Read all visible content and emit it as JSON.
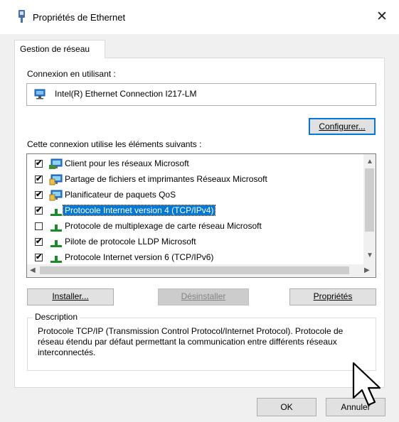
{
  "window": {
    "title": "Propriétés de Ethernet",
    "close_glyph": "✕"
  },
  "tabs": [
    {
      "label": "Gestion de réseau"
    }
  ],
  "connection": {
    "label": "Connexion en utilisant :",
    "adapter": "Intel(R) Ethernet Connection I217-LM",
    "configure_label": "Configurer..."
  },
  "components": {
    "label": "Cette connexion utilise les éléments suivants :",
    "items": [
      {
        "label": "Client pour les réseaux Microsoft",
        "checked": true,
        "icon": "network-client-icon"
      },
      {
        "label": "Partage de fichiers et imprimantes Réseaux Microsoft",
        "checked": true,
        "icon": "network-service-icon"
      },
      {
        "label": "Planificateur de paquets QoS",
        "checked": true,
        "icon": "network-service-icon"
      },
      {
        "label": "Protocole Internet version 4 (TCP/IPv4)",
        "checked": true,
        "icon": "protocol-icon",
        "selected": true
      },
      {
        "label": "Protocole de multiplexage de carte réseau Microsoft",
        "checked": false,
        "icon": "protocol-icon"
      },
      {
        "label": "Pilote de protocole LLDP Microsoft",
        "checked": true,
        "icon": "protocol-icon"
      },
      {
        "label": "Protocole Internet version 6 (TCP/IPv6)",
        "checked": true,
        "icon": "protocol-icon"
      }
    ]
  },
  "buttons": {
    "install": "Installer...",
    "uninstall": "Désinstaller",
    "properties": "Propriétés",
    "ok": "OK",
    "cancel": "Annuler"
  },
  "description": {
    "legend": "Description",
    "text": "Protocole TCP/IP (Transmission Control Protocol/Internet Protocol). Protocole de réseau étendu par défaut permettant la communication entre différents réseaux interconnectés."
  },
  "colors": {
    "selection": "#0078d7",
    "protocol_green": "#1a8a2a",
    "monitor_blue": "#2a7fd4"
  }
}
